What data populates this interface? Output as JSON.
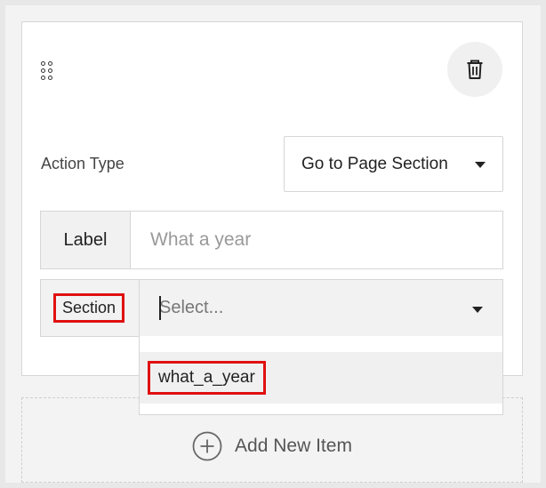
{
  "item": {
    "drag_icon": "drag-handle-icon",
    "delete_icon": "trash-icon",
    "action_type": {
      "label": "Action Type",
      "selected": "Go to Page Section"
    },
    "label_field": {
      "tag": "Label",
      "placeholder": "What a year"
    },
    "section_field": {
      "tag": "Section",
      "placeholder": "Select..."
    },
    "dropdown": {
      "options": [
        "what_a_year"
      ]
    }
  },
  "add_new": {
    "icon": "plus-circle-icon",
    "label": "Add New Item"
  },
  "colors": {
    "highlight": "#e01010"
  }
}
